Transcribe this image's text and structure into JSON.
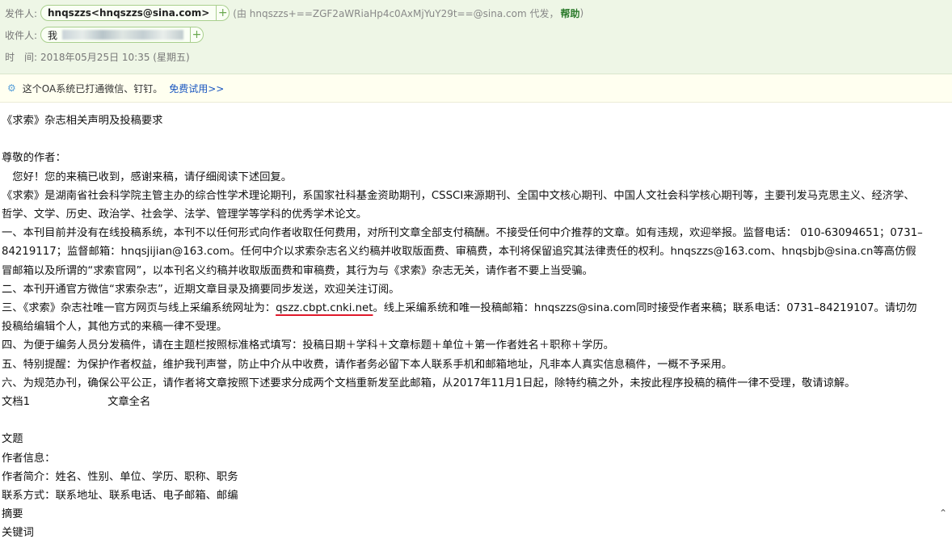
{
  "header": {
    "from_label": "发件人:",
    "from_chip": "hnqszzs<hnqszzs@sina.com>",
    "from_via": "(由 hnqszzs+==ZGF2aWRiaHp4c0AxMjYuY29t==@sina.com 代发，",
    "help": "帮助",
    "from_tail": ")",
    "to_label": "收件人:",
    "to_chip": "我",
    "time_label": "时　间:",
    "time_value": "2018年05月25日 10:35 (星期五)",
    "add_glyph": "+"
  },
  "notice": {
    "text": "这个OA系统已打通微信、钉钉。",
    "trial": "免费试用>>"
  },
  "body": {
    "title": "《求索》杂志相关声明及投稿要求",
    "greeting": "尊敬的作者：",
    "intro": "　您好！您的来稿已收到，感谢来稿，请仔细阅读下述回复。",
    "p_about": "《求索》是湖南省社会科学院主管主办的综合性学术理论期刊，系国家社科基金资助期刊，CSSCI来源期刊、全国中文核心期刊、中国人文社会科学核心期刊等，主要刊发马克思主义、经济学、哲学、文学、历史、政治学、社会学、法学、管理学等学科的优秀学术论文。",
    "p1": "一、本刊目前并没有在线投稿系统，本刊不以任何形式向作者收取任何费用，对所刊文章全部支付稿酬。不接受任何中介推荐的文章。如有违规，欢迎举报。监督电话： 010-63094651；0731–84219117；监督邮箱：hnqsjijian@163.com。任何中介以求索杂志名义约稿并收取版面费、审稿费，本刊将保留追究其法律责任的权利。hnqszzs@163.com、hnqsbjb@sina.cn等高仿假冒邮箱以及所谓的“求索官网”，以本刊名义约稿并收取版面费和审稿费，其行为与《求索》杂志无关，请作者不要上当受骗。",
    "p2": "二、本刊开通官方微信“求索杂志”，近期文章目录及摘要同步发送，欢迎关注订阅。",
    "p3_pre": "三、《求索》杂志社唯一官方网页与线上采编系统网址为：",
    "p3_url": "qszz.cbpt.cnki.net",
    "p3_post": "。线上采编系统和唯一投稿邮箱：hnqszzs@sina.com同时接受作者来稿；联系电话：0731–84219107。请切勿投稿给编辑个人，其他方式的来稿一律不受理。",
    "p4": "四、为便于编务人员分发稿件，请在主题栏按照标准格式填写：投稿日期＋学科＋文章标题＋单位＋第一作者姓名＋职称＋学历。",
    "p5": "五、特别提醒：为保护作者权益，维护我刊声誉，防止中介从中收费，请作者务必留下本人联系手机和邮箱地址，凡非本人真实信息稿件，一概不予采用。",
    "p6": "六、为规范办刊，确保公平公正，请作者将文章按照下述要求分成两个文档重新发至此邮箱，从2017年11月1日起，除特约稿之外，未按此程序投稿的稿件一律不受理，敬请谅解。",
    "doc1_label": "文档1",
    "doc1_value": "文章全名",
    "l_title": "文题",
    "l_author_info": "作者信息：",
    "l_author_bio": "作者简介：姓名、性别、单位、学历、职称、职务",
    "l_contact": "联系方式：联系地址、联系电话、电子邮箱、邮编",
    "l_abstract": "摘要",
    "l_keywords": "关键词"
  },
  "colors": {
    "header_bg": "#eef6e6",
    "notice_bg": "#fffff0",
    "link": "#1a56c0",
    "underline": "#e0192b"
  }
}
